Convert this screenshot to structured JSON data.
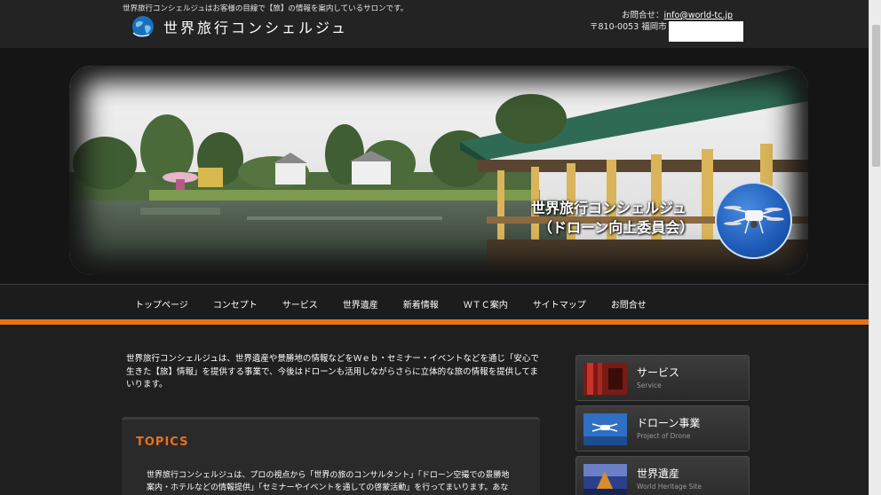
{
  "header": {
    "tagline": "世界旅行コンシェルジュはお客様の目線で【旅】の情報を案内しているサロンです。",
    "logo_text": "世界旅行コンシェルジュ",
    "contact_label": "お問合せ：",
    "contact_email": "info@world-tc.jp",
    "address": "〒810-0053 福岡市"
  },
  "hero": {
    "caption_line1": "世界旅行コンシェルジュ",
    "caption_line2": "（ドローン向上委員会）"
  },
  "nav": {
    "items": [
      "トップページ",
      "コンセプト",
      "サービス",
      "世界遺産",
      "新着情報",
      "ＷＴＣ案内",
      "サイトマップ",
      "お問合せ"
    ]
  },
  "main": {
    "intro": "世界旅行コンシェルジュは、世界遺産や景勝地の情報などをＷｅｂ・セミナー・イベントなどを通じ「安心で生きた【旅】情報」を提供する事業で、今後はドローンも活用しながらさらに立体的な旅の情報を提供してまいります。",
    "topics_title": "TOPICS",
    "topics_text": "世界旅行コンシェルジュは、プロの視点から「世界の旅のコンサルタント」「ドローン空撮での景勝地案内・ホテルなどの情報提供」「セミナーやイベントを通しての啓蒙活動」を行ってまいります。あなたの"
  },
  "sidebar": {
    "cards": [
      {
        "title": "サービス",
        "subtitle": "Service"
      },
      {
        "title": "ドローン事業",
        "subtitle": "Project of Drone"
      },
      {
        "title": "世界遺産",
        "subtitle": "World Heritage Site"
      }
    ]
  },
  "colors": {
    "accent": "#e8721c",
    "background": "#1e1e1e"
  }
}
